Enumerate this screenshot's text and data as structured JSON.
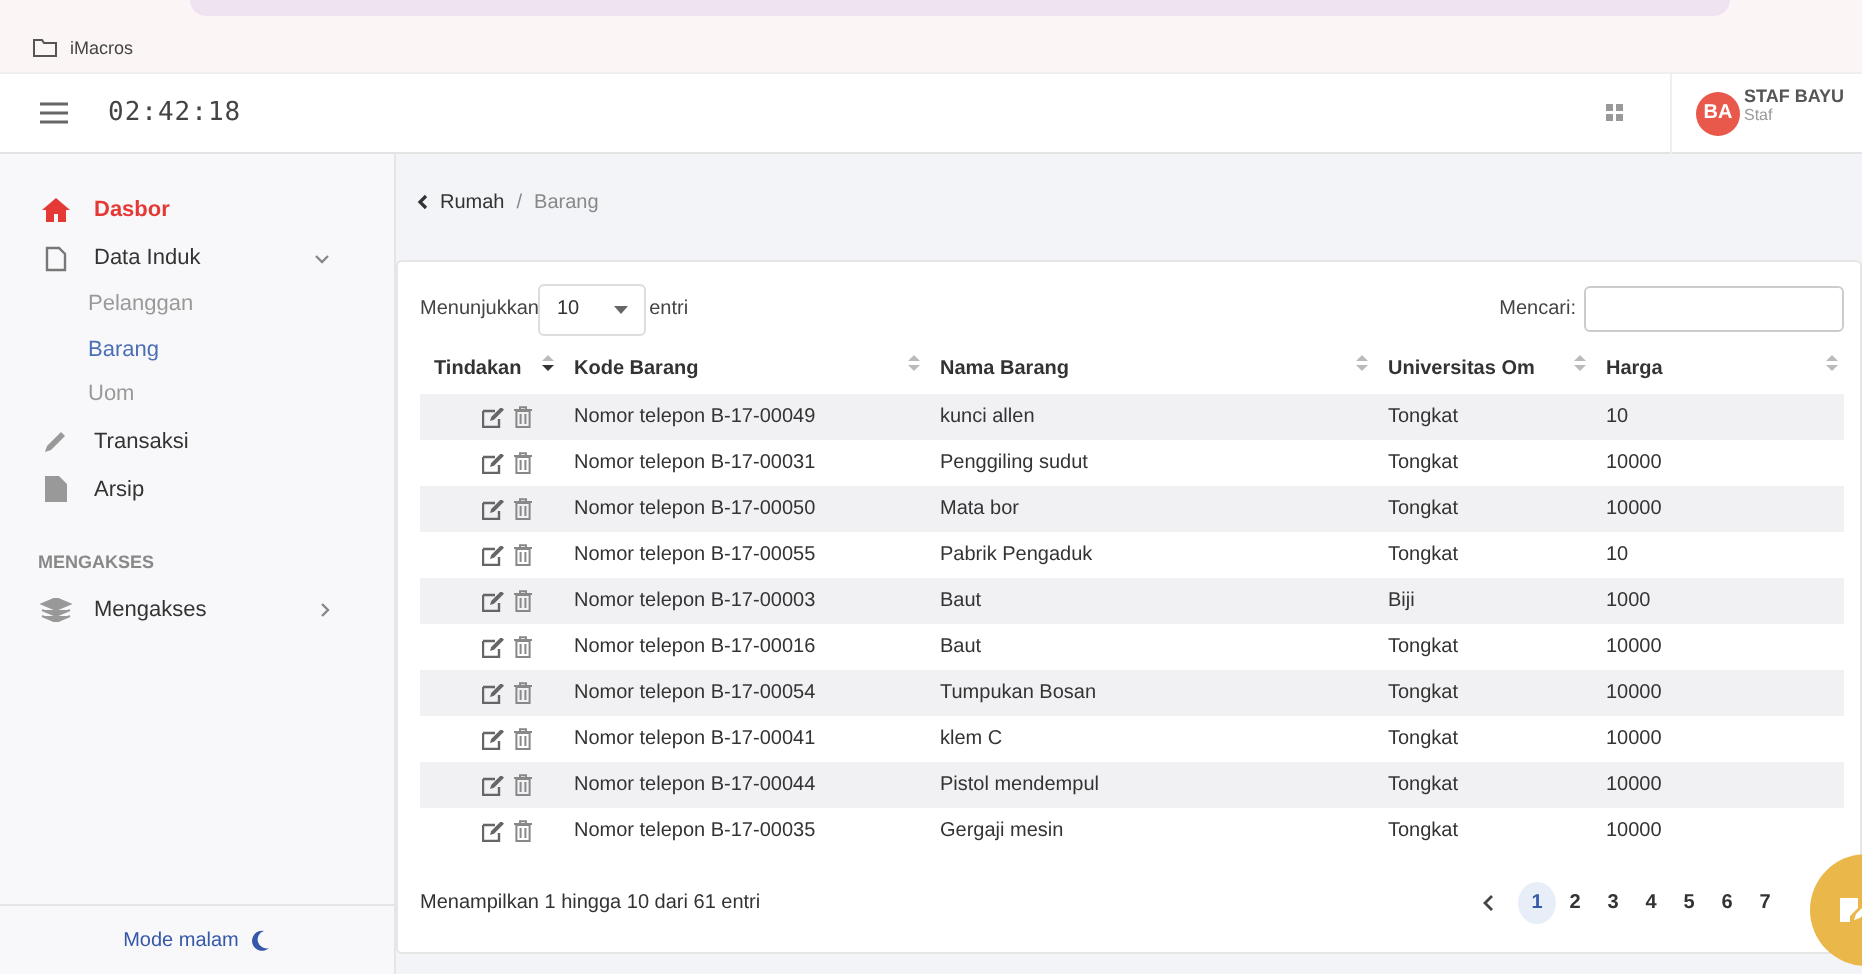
{
  "browser": {
    "bookmark": "iMacros"
  },
  "header": {
    "clock": "02:42:18",
    "user": {
      "initials": "BA",
      "name": "STAF BAYU",
      "role": "Staf"
    }
  },
  "sidebar": {
    "items": [
      {
        "kind": "item",
        "label": "Dasbor",
        "selected": true
      },
      {
        "kind": "item",
        "label": "Data Induk",
        "selected": false,
        "expanded": true,
        "children": [
          {
            "label": "Pelanggan",
            "selected": false
          },
          {
            "label": "Barang",
            "selected": true
          },
          {
            "label": "Uom",
            "selected": false
          }
        ]
      },
      {
        "kind": "item",
        "label": "Transaksi",
        "selected": false
      },
      {
        "kind": "item",
        "label": "Arsip",
        "selected": false
      },
      {
        "kind": "section",
        "label": "MENGAKSES"
      },
      {
        "kind": "item",
        "label": "Mengakses",
        "selected": false,
        "expanded": false
      }
    ],
    "footer": "Mode malam"
  },
  "breadcrumb": [
    "Rumah",
    "Barang"
  ],
  "breadcrumb_separator": "/",
  "table": {
    "length_label": "Menunjukkan",
    "length_value": "10",
    "length_suffix": "entri",
    "search_label": "Mencari:",
    "columns": [
      {
        "label": "Tindakan",
        "sorted": true
      },
      {
        "label": "Kode Barang",
        "sorted": false
      },
      {
        "label": "Nama Barang",
        "sorted": false
      },
      {
        "label": "Universitas Om",
        "sorted": false
      },
      {
        "label": "Harga",
        "sorted": false
      }
    ],
    "rows": [
      {
        "code": "Nomor telepon B-17-00049",
        "name": "kunci allen",
        "unit": "Tongkat",
        "price": "10"
      },
      {
        "code": "Nomor telepon B-17-00031",
        "name": "Penggiling sudut",
        "unit": "Tongkat",
        "price": "10000"
      },
      {
        "code": "Nomor telepon B-17-00050",
        "name": "Mata bor",
        "unit": "Tongkat",
        "price": "10000"
      },
      {
        "code": "Nomor telepon B-17-00055",
        "name": "Pabrik Pengaduk",
        "unit": "Tongkat",
        "price": "10"
      },
      {
        "code": "Nomor telepon B-17-00003",
        "name": "Baut",
        "unit": "Biji",
        "price": "1000"
      },
      {
        "code": "Nomor telepon B-17-00016",
        "name": "Baut",
        "unit": "Tongkat",
        "price": "10000"
      },
      {
        "code": "Nomor telepon B-17-00054",
        "name": "Tumpukan Bosan",
        "unit": "Tongkat",
        "price": "10000"
      },
      {
        "code": "Nomor telepon B-17-00041",
        "name": "klem C",
        "unit": "Tongkat",
        "price": "10000"
      },
      {
        "code": "Nomor telepon B-17-00044",
        "name": "Pistol mendempul",
        "unit": "Tongkat",
        "price": "10000"
      },
      {
        "code": "Nomor telepon B-17-00035",
        "name": "Gergaji mesin",
        "unit": "Tongkat",
        "price": "10000"
      }
    ],
    "info": "Menampilkan 1 hingga 10 dari 61 entri",
    "pages": [
      {
        "label": "1",
        "selected": true
      },
      {
        "label": "2",
        "selected": false
      },
      {
        "label": "3",
        "selected": false
      },
      {
        "label": "4",
        "selected": false
      },
      {
        "label": "5",
        "selected": false
      },
      {
        "label": "6",
        "selected": false
      },
      {
        "label": "7",
        "selected": false
      }
    ]
  }
}
